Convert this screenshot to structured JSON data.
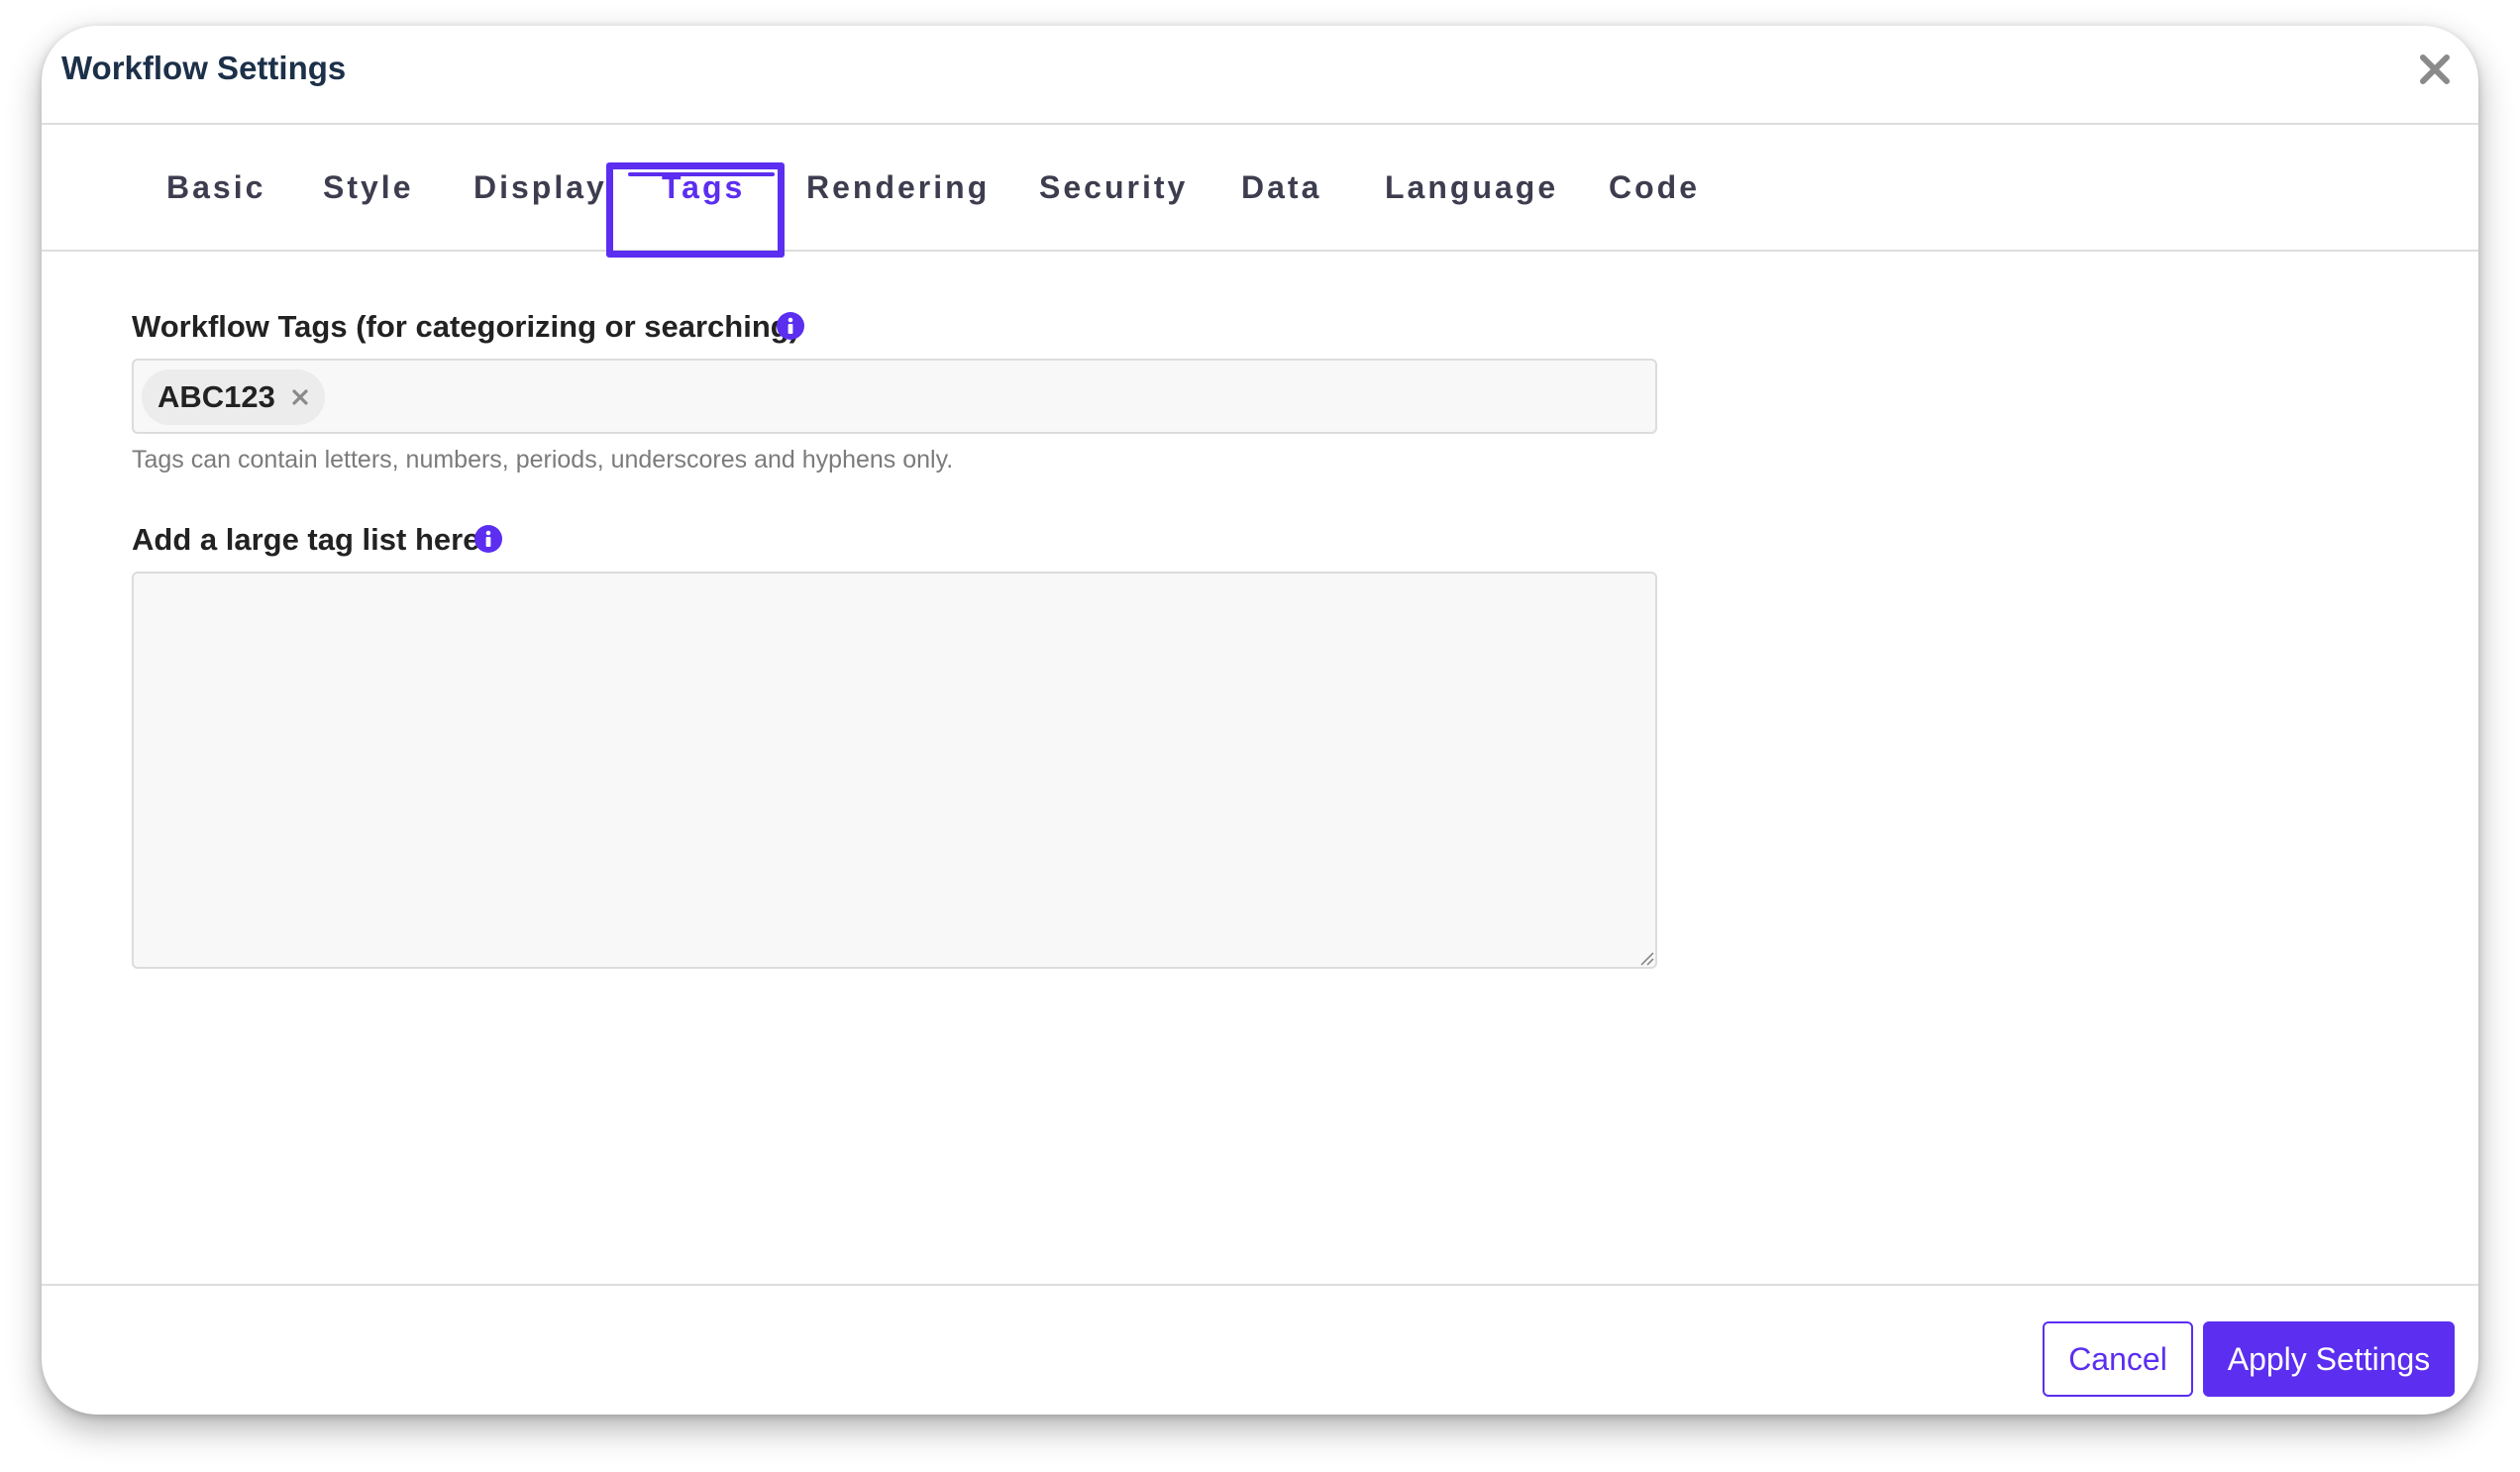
{
  "dialog": {
    "title": "Workflow Settings",
    "close_icon": "close-icon"
  },
  "tabs": [
    {
      "label": "Basic",
      "active": false
    },
    {
      "label": "Style",
      "active": false
    },
    {
      "label": "Display",
      "active": false
    },
    {
      "label": "Tags",
      "active": true
    },
    {
      "label": "Rendering",
      "active": false
    },
    {
      "label": "Security",
      "active": false
    },
    {
      "label": "Data",
      "active": false
    },
    {
      "label": "Language",
      "active": false
    },
    {
      "label": "Code",
      "active": false
    }
  ],
  "tags_field": {
    "label": "Workflow Tags (for categorizing or searching)",
    "info_icon": "info-icon",
    "tags": [
      "ABC123"
    ],
    "remove_icon": "close-icon",
    "help": "Tags can contain letters, numbers, periods, underscores and hyphens only."
  },
  "tag_list_field": {
    "label": "Add a large tag list here",
    "info_icon": "info-icon",
    "value": ""
  },
  "footer": {
    "cancel_label": "Cancel",
    "apply_label": "Apply Settings"
  },
  "colors": {
    "accent": "#5b2ef0",
    "title": "#1c3049",
    "help_text": "#7b7b7b"
  }
}
